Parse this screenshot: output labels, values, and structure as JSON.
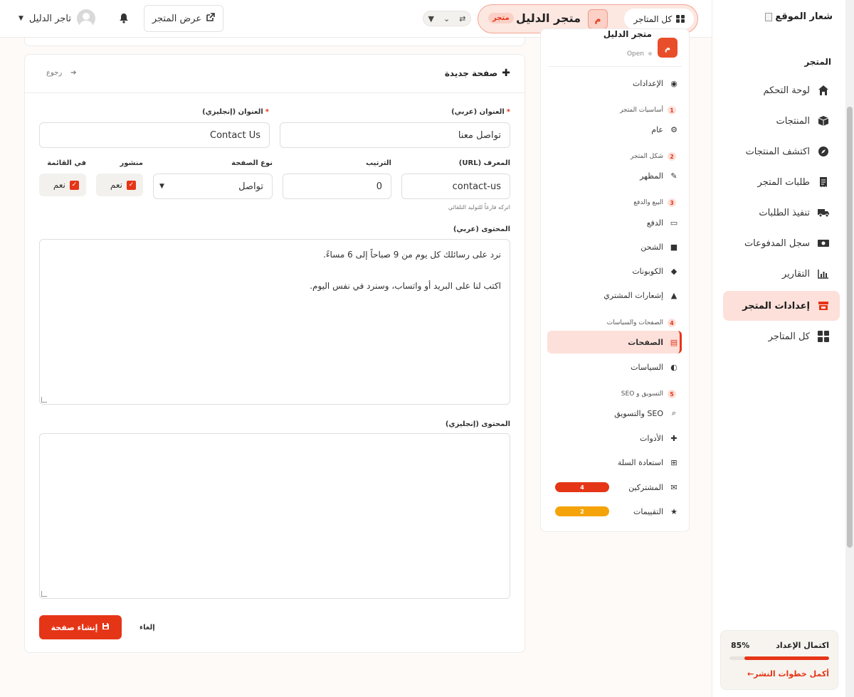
{
  "sidebar": {
    "logo_alt": "شعار الموقع",
    "section_label": "المتجر",
    "items": [
      {
        "label": "لوحة التحكم",
        "icon": "home-icon"
      },
      {
        "label": "المنتجات",
        "icon": "box-icon"
      },
      {
        "label": "اكتشف المنتجات",
        "icon": "compass-icon"
      },
      {
        "label": "طلبات المتجر",
        "icon": "receipt-icon"
      },
      {
        "label": "تنفيذ الطلبات",
        "icon": "truck-icon"
      },
      {
        "label": "سجل المدفوعات",
        "icon": "money-icon"
      },
      {
        "label": "التقارير",
        "icon": "chart-icon"
      },
      {
        "label": "إعدادات المتجر",
        "icon": "store-icon",
        "active": true
      },
      {
        "label": "كل المتاجر",
        "icon": "grid-icon"
      }
    ],
    "setup_progress": {
      "title": "اكتمال الإعداد",
      "percent_label": "85%",
      "percent": 85,
      "link": "أكمل خطوات النشر←"
    }
  },
  "topbar": {
    "all_stores": "كل المتاجر",
    "store_initial": "م",
    "store_name": "متجر الدليل",
    "store_badge": "متجر",
    "view_store": "عرض المتجر",
    "user_name": "تاجر الدليل"
  },
  "settings_nav": {
    "store_name": "متجر الدليل",
    "store_initial": "م",
    "store_status": "Open",
    "items": {
      "settings": "الإعدادات",
      "group1": {
        "num": "1",
        "label": "أساسيات المتجر"
      },
      "general": "عام",
      "group2": {
        "num": "2",
        "label": "شكل المتجر"
      },
      "appearance": "المظهر",
      "group3": {
        "num": "3",
        "label": "البيع والدفع"
      },
      "payment": "الدفع",
      "shipping": "الشحن",
      "coupons": "الكوبونات",
      "notifications": "إشعارات المشتري",
      "group4": {
        "num": "4",
        "label": "الصفحات والسياسات"
      },
      "pages": "الصفحات",
      "policies": "السياسات",
      "group5": {
        "num": "5",
        "label": "التسويق و SEO"
      },
      "seo": "SEO والتسويق",
      "tools": "الأدوات",
      "cart_recovery": "استعادة السلة",
      "subscribers": "المشتركين",
      "subscribers_count": "4",
      "reviews": "التقييمات",
      "reviews_count": "2"
    },
    "colors": {
      "subscribers_badge": "#e53517",
      "reviews_badge": "#f5a30a"
    }
  },
  "form": {
    "title": "صفحة جديدة",
    "back": "رجوع",
    "title_ar_label": "العنوان (عربي)",
    "title_ar_value": "تواصل معنا",
    "title_en_label": "العنوان (إنجليزي)",
    "title_en_value": "Contact Us",
    "slug_label": "المعرف (URL)",
    "slug_value": "contact-us",
    "slug_hint": "اتركه فارغاً للتوليد التلقائي",
    "order_label": "الترتيب",
    "order_value": "0",
    "type_label": "نوع الصفحة",
    "type_value": "تواصل",
    "published_label": "منشور",
    "published_value": "نعم",
    "in_menu_label": "في القائمة",
    "in_menu_value": "نعم",
    "content_ar_label": "المحتوى (عربي)",
    "content_ar_value": "نرد على رسائلك كل يوم من 9 صباحاً إلى 6 مساءً.\n\nاكتب لنا على البريد أو واتساب، وسنرد في نفس اليوم.",
    "content_en_label": "المحتوى (إنجليزي)",
    "content_en_value": "",
    "create_button": "إنشاء صفحة",
    "cancel_button": "إلغاء"
  },
  "colors": {
    "accent": "#e53517",
    "accent_light": "#fde0da"
  }
}
